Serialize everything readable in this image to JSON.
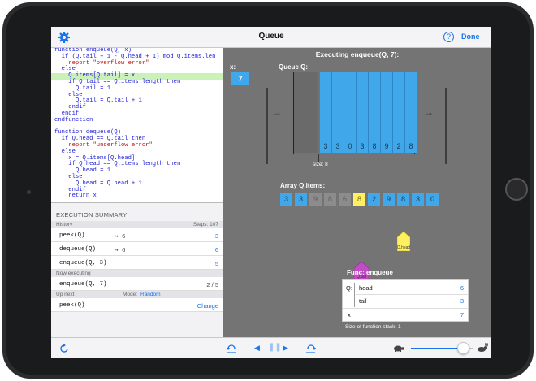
{
  "navbar": {
    "title": "Queue",
    "help_label": "?",
    "done_label": "Done"
  },
  "code": {
    "lines": [
      {
        "t": "function enqueue(Q, x)",
        "hl": false,
        "c": "kw"
      },
      {
        "t": "  if (Q.tail + 1 - Q.head + 1) mod Q.items.len",
        "hl": false,
        "c": "kw"
      },
      {
        "t": "    report \"overflow error\"",
        "hl": false,
        "c": "st"
      },
      {
        "t": "  else",
        "hl": false,
        "c": "kw"
      },
      {
        "t": "    Q.items[Q.tail] = x",
        "hl": true,
        "c": "tx"
      },
      {
        "t": "    if Q.tail == Q.items.length then",
        "hl": false,
        "c": "kw"
      },
      {
        "t": "      Q.tail = 1",
        "hl": false,
        "c": "tx"
      },
      {
        "t": "    else",
        "hl": false,
        "c": "kw"
      },
      {
        "t": "      Q.tail = Q.tail + 1",
        "hl": false,
        "c": "tx"
      },
      {
        "t": "    endif",
        "hl": false,
        "c": "kw"
      },
      {
        "t": "  endif",
        "hl": false,
        "c": "kw"
      },
      {
        "t": "endfunction",
        "hl": false,
        "c": "kw"
      },
      {
        "t": "",
        "hl": false,
        "c": "tx"
      },
      {
        "t": "function dequeue(Q)",
        "hl": false,
        "c": "kw"
      },
      {
        "t": "  if Q.head == Q.tail then",
        "hl": false,
        "c": "kw"
      },
      {
        "t": "    report \"underflow error\"",
        "hl": false,
        "c": "st"
      },
      {
        "t": "  else",
        "hl": false,
        "c": "kw"
      },
      {
        "t": "    x = Q.items[Q.head]",
        "hl": false,
        "c": "tx"
      },
      {
        "t": "    if Q.head == Q.items.length then",
        "hl": false,
        "c": "kw"
      },
      {
        "t": "      Q.head = 1",
        "hl": false,
        "c": "tx"
      },
      {
        "t": "    else",
        "hl": false,
        "c": "kw"
      },
      {
        "t": "      Q.head = Q.head + 1",
        "hl": false,
        "c": "tx"
      },
      {
        "t": "    endif",
        "hl": false,
        "c": "kw"
      },
      {
        "t": "    return x",
        "hl": false,
        "c": "kw"
      }
    ]
  },
  "summary": {
    "header": "EXECUTION SUMMARY",
    "history_label": "History",
    "steps_label": "Steps: 107",
    "history": [
      {
        "call": "peek(Q)",
        "ret": "↪ 6",
        "steps": "3"
      },
      {
        "call": "dequeue(Q)",
        "ret": "↪ 6",
        "steps": "6"
      },
      {
        "call": "enqueue(Q, 3)",
        "ret": "",
        "steps": "5"
      }
    ],
    "now_label": "Now executing",
    "now_call": "enqueue(Q, 7)",
    "now_steps": "2 / 5",
    "upnext_label": "Up next",
    "mode_label": "Mode:",
    "mode_value": "Random",
    "next_call": "peek(Q)",
    "change_label": "Change"
  },
  "visual": {
    "exec_title": "Executing enqueue(Q, 7):",
    "x_label": "x:",
    "x_value": "7",
    "queue_label": "Queue Q:",
    "queue_values": [
      "3",
      "3",
      "0",
      "3",
      "8",
      "9",
      "2",
      "8"
    ],
    "size_label": "size: 8",
    "array_label": "Array Q.items:",
    "array_values": [
      "3",
      "3",
      "9",
      "8",
      "6",
      "8",
      "2",
      "9",
      "8",
      "3",
      "0"
    ],
    "array_states": [
      "blue",
      "blue",
      "grey",
      "grey",
      "grey",
      "yellow",
      "blue",
      "blue",
      "blue",
      "blue",
      "blue"
    ],
    "head_pointer_label": "Q.head",
    "tail_pointer_label": "Q.tail",
    "func_title": "Func: enqueue",
    "func_q_label": "Q:",
    "func_head_label": "head",
    "func_head_value": "6",
    "func_tail_label": "tail",
    "func_tail_value": "3",
    "func_x_label": "x",
    "func_x_value": "7",
    "stack_label": "Size of function stack: 1"
  },
  "colors": {
    "accent": "#1a73e8",
    "cell_blue": "#3fa7ea",
    "cell_yellow": "#fff060",
    "highlight": "#c9f1b8",
    "pointer_purple": "#c04ec2"
  },
  "icons": {
    "settings": "gear-icon",
    "restart": "restart-icon",
    "undo": "step-back-icon",
    "rewind": "rewind-icon",
    "pause": "pause-icon",
    "play": "play-icon",
    "redo": "step-forward-icon",
    "turtle": "turtle-icon",
    "rabbit": "rabbit-icon"
  }
}
